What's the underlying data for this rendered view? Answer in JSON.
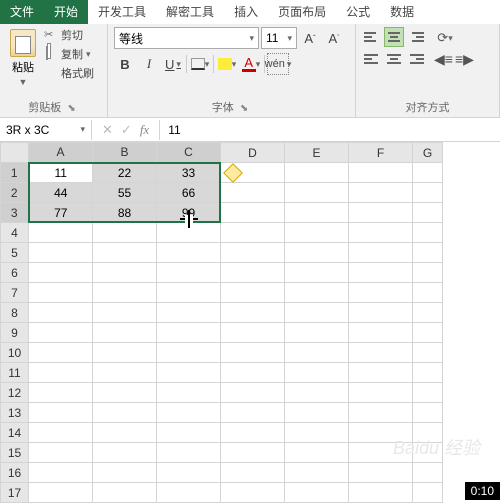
{
  "tabs": {
    "file": "文件",
    "home": "开始",
    "dev": "开发工具",
    "dec": "解密工具",
    "insert": "插入",
    "layout": "页面布局",
    "formula": "公式",
    "data": "数据"
  },
  "clipboard": {
    "cut": "剪切",
    "copy": "复制",
    "painter": "格式刷",
    "paste": "粘贴",
    "group": "剪贴板"
  },
  "font": {
    "name": "等线",
    "size": "11",
    "group": "字体",
    "bold": "B",
    "italic": "I",
    "underline": "U",
    "fontA": "A",
    "wen": "wén",
    "Aplus": "A",
    "Aminus": "A"
  },
  "align": {
    "group": "对齐方式"
  },
  "namebox": "3R x 3C",
  "formula_value": "11",
  "cols": [
    "A",
    "B",
    "C",
    "D",
    "E",
    "F",
    "G"
  ],
  "rows": [
    "1",
    "2",
    "3",
    "4",
    "5",
    "6",
    "7",
    "8",
    "9",
    "10",
    "11",
    "12",
    "13",
    "14",
    "15",
    "16",
    "17"
  ],
  "cells": {
    "r1": {
      "A": "11",
      "B": "22",
      "C": "33"
    },
    "r2": {
      "A": "44",
      "B": "55",
      "C": "66"
    },
    "r3": {
      "A": "77",
      "B": "88",
      "C": "99"
    }
  },
  "video_time": "0:10",
  "watermark": "Baidu 经验"
}
